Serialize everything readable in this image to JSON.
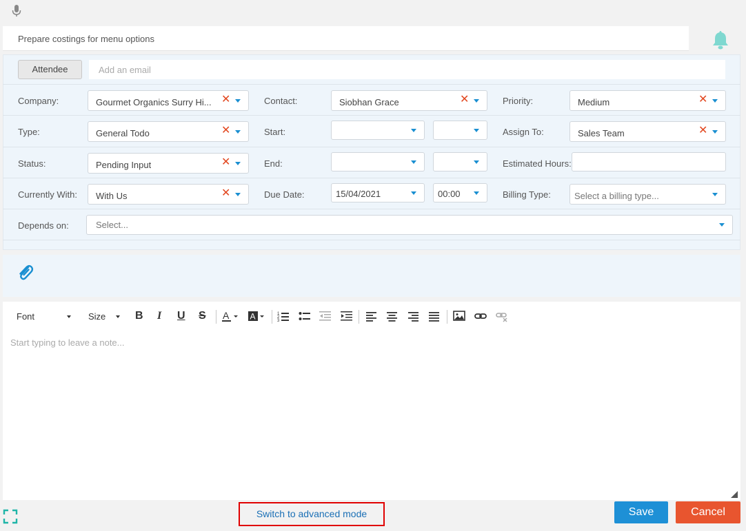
{
  "task": {
    "title": "Prepare costings for menu options"
  },
  "attendee": {
    "button_label": "Attendee",
    "email_placeholder": "Add an email"
  },
  "fields": {
    "company": {
      "label": "Company:",
      "value": "Gourmet Organics Surry Hi..."
    },
    "contact": {
      "label": "Contact:",
      "value": "Siobhan Grace"
    },
    "priority": {
      "label": "Priority:",
      "value": "Medium"
    },
    "type": {
      "label": "Type:",
      "value": "General Todo"
    },
    "start": {
      "label": "Start:",
      "date": "",
      "time": ""
    },
    "assign_to": {
      "label": "Assign To:",
      "value": "Sales Team"
    },
    "status": {
      "label": "Status:",
      "value": "Pending Input"
    },
    "end": {
      "label": "End:",
      "date": "",
      "time": ""
    },
    "estimated_hours": {
      "label": "Estimated Hours:",
      "value": ""
    },
    "currently_with": {
      "label": "Currently With:",
      "value": "With Us"
    },
    "due_date": {
      "label": "Due Date:",
      "date": "15/04/2021",
      "time": "00:00"
    },
    "billing_type": {
      "label": "Billing Type:",
      "placeholder": "Select a billing type..."
    },
    "depends_on": {
      "label": "Depends on:",
      "placeholder": "Select..."
    }
  },
  "editor": {
    "font_label": "Font",
    "size_label": "Size",
    "placeholder": "Start typing to leave a note..."
  },
  "footer": {
    "advanced_link": "Switch to advanced mode",
    "save_label": "Save",
    "cancel_label": "Cancel"
  },
  "colors": {
    "accent": "#1e90d6",
    "danger": "#e8552f",
    "clear_x": "#e2471f",
    "bell": "#7fd8d0",
    "highlight": "#e00000"
  }
}
